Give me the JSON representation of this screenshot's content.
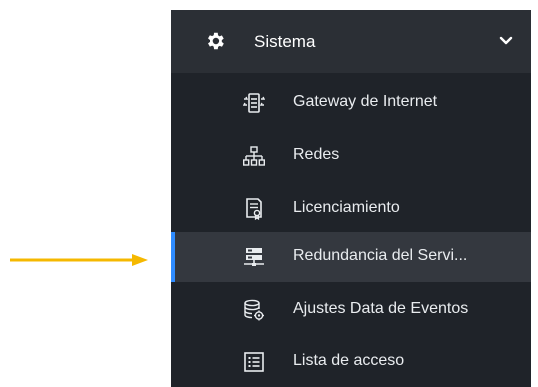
{
  "colors": {
    "sidebar_bg": "#1f2329",
    "header_bg": "#2b2f35",
    "active_bg": "#34383f",
    "active_indicator": "#2f8cff",
    "arrow": "#f5b800"
  },
  "sidebar": {
    "section": {
      "label": "Sistema",
      "icon": "gear-icon",
      "expanded_icon": "chevron-down-icon"
    },
    "items": [
      {
        "label": "Gateway de Internet",
        "icon": "gateway-icon"
      },
      {
        "label": "Redes",
        "icon": "network-icon"
      },
      {
        "label": "Licenciamiento",
        "icon": "license-icon"
      },
      {
        "label": "Redundancia del Servi...",
        "icon": "redundancy-icon",
        "active": true
      },
      {
        "label": "Ajustes Data de Eventos",
        "icon": "event-data-settings-icon"
      },
      {
        "label": "Lista de acceso",
        "icon": "access-list-icon"
      }
    ]
  },
  "annotation": {
    "icon": "pointer-arrow-icon"
  }
}
